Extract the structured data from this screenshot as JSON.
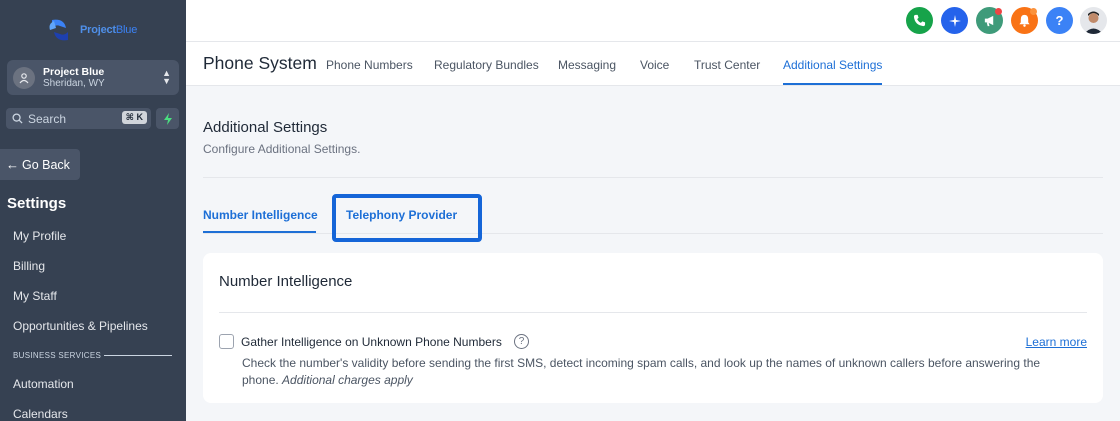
{
  "sidebar": {
    "logo_text": "Project",
    "logo_text_thin": "Blue",
    "account": {
      "name": "Project Blue",
      "location": "Sheridan, WY"
    },
    "search": {
      "placeholder": "Search",
      "shortcut": "⌘ K"
    },
    "go_back": "Go Back",
    "settings_title": "Settings",
    "items": [
      {
        "label": "My Profile"
      },
      {
        "label": "Billing"
      },
      {
        "label": "My Staff"
      },
      {
        "label": "Opportunities & Pipelines"
      },
      {
        "label": "Automation"
      },
      {
        "label": "Calendars"
      }
    ],
    "section_label": "BUSINESS SERVICES"
  },
  "topbar": {
    "icons": [
      {
        "name": "phone-icon",
        "color": "#16a34a"
      },
      {
        "name": "sparkle-icon",
        "color": "#2563eb"
      },
      {
        "name": "megaphone-icon",
        "color": "#3f9b7a"
      },
      {
        "name": "bell-icon",
        "color": "#f97316"
      },
      {
        "name": "help-icon",
        "color": "#3b82f6"
      }
    ]
  },
  "subnav": {
    "page_title": "Phone System",
    "tabs": [
      {
        "label": "Phone Numbers"
      },
      {
        "label": "Regulatory Bundles"
      },
      {
        "label": "Messaging"
      },
      {
        "label": "Voice"
      },
      {
        "label": "Trust Center"
      },
      {
        "label": "Additional Settings"
      }
    ]
  },
  "main": {
    "title": "Additional Settings",
    "subtitle": "Configure Additional Settings.",
    "tabs": [
      {
        "label": "Number Intelligence"
      },
      {
        "label": "Telephony Provider"
      }
    ],
    "card": {
      "title": "Number Intelligence",
      "option_label": "Gather Intelligence on Unknown Phone Numbers",
      "learn_more": "Learn more",
      "description": "Check the number's validity before sending the first SMS, detect incoming spam calls, and look up the names of unknown callers before answering the phone.",
      "description_note": "Additional charges apply"
    }
  },
  "colors": {
    "accent": "#1d6fd6",
    "sidebar_bg": "#364152"
  }
}
